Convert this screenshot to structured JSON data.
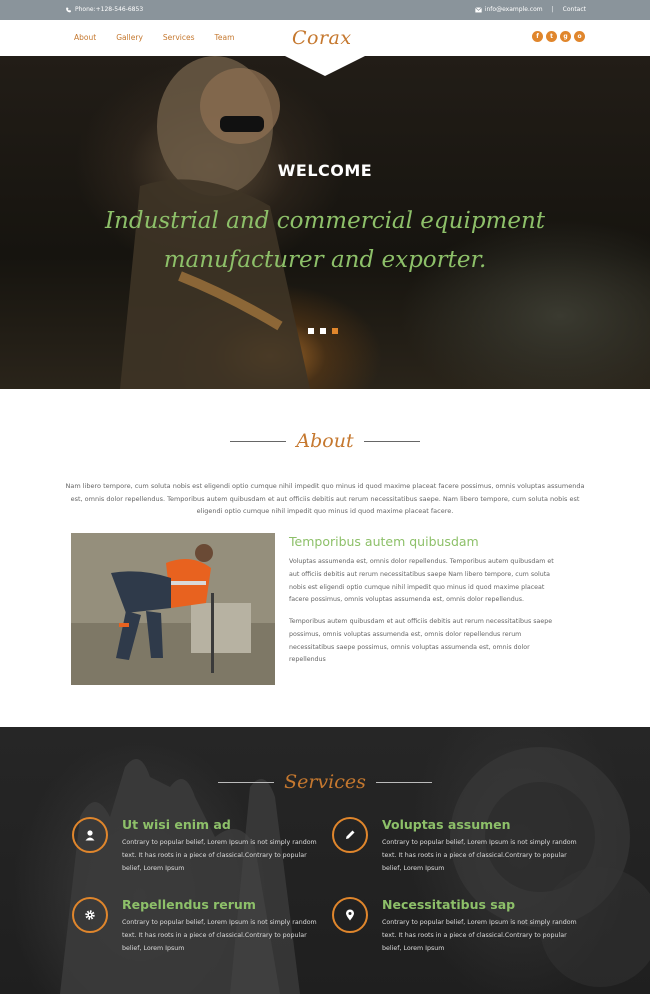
{
  "topbar": {
    "phone": "Phone:+128-546-6853",
    "email": "info@example.com",
    "separator": "|",
    "contact": "Contact"
  },
  "header": {
    "nav": [
      "About",
      "Gallery",
      "Services",
      "Team"
    ],
    "logo": "Corax",
    "social_icons": [
      "facebook-icon",
      "twitter-icon",
      "google-plus-icon",
      "instagram-icon"
    ]
  },
  "hero": {
    "welcome": "WELCOME",
    "tagline_line1": "Industrial and commercial equipment",
    "tagline_line2": "manufacturer and exporter.",
    "slides": 3,
    "active_slide": 3
  },
  "about": {
    "title": "About",
    "intro": "Nam libero tempore, cum soluta nobis est eligendi optio cumque nihil impedit quo minus id quod maxime placeat facere possimus, omnis voluptas assumenda est, omnis dolor repellendus. Temporibus autem quibusdam et aut officiis debitis aut rerum necessitatibus saepe. Nam libero tempore, cum soluta nobis est eligendi optio cumque nihil impedit quo minus id quod maxime placeat facere.",
    "heading": "Temporibus autem quibusdam",
    "para1": "Voluptas assumenda est, omnis dolor repellendus. Temporibus autem quibusdam et aut officiis debitis aut rerum necessitatibus saepe Nam libero tempore, cum soluta nobis est eligendi optio cumque nihil impedit quo minus id quod maxime placeat facere possimus, omnis voluptas assumenda est, omnis dolor repellendus.",
    "para2": "Temporibus autem quibusdam et aut officiis debitis aut rerum necessitatibus saepe possimus, omnis voluptas assumenda est, omnis dolor repellendus rerum necessitatibus saepe possimus, omnis voluptas assumenda est, omnis dolor repellendus"
  },
  "services": {
    "title": "Services",
    "items": [
      {
        "icon": "user-icon",
        "title": "Ut wisi enim ad",
        "text": "Contrary to popular belief, Lorem Ipsum is not simply random text. It has roots in a piece of classical.Contrary to popular belief, Lorem Ipsum"
      },
      {
        "icon": "pencil-icon",
        "title": "Voluptas assumen",
        "text": "Contrary to popular belief, Lorem Ipsum is not simply random text. It has roots in a piece of classical.Contrary to popular belief, Lorem Ipsum"
      },
      {
        "icon": "gear-icon",
        "title": "Repellendus rerum",
        "text": "Contrary to popular belief, Lorem Ipsum is not simply random text. It has roots in a piece of classical.Contrary to popular belief, Lorem Ipsum"
      },
      {
        "icon": "map-marker-icon",
        "title": "Necessitatibus sap",
        "text": "Contrary to popular belief, Lorem Ipsum is not simply random text. It has roots in a piece of classical.Contrary to popular belief, Lorem Ipsum"
      }
    ]
  },
  "colors": {
    "accent": "#e0862c",
    "brand_text": "#c5782f",
    "green": "#8dc069",
    "topbar": "#8a949b"
  }
}
